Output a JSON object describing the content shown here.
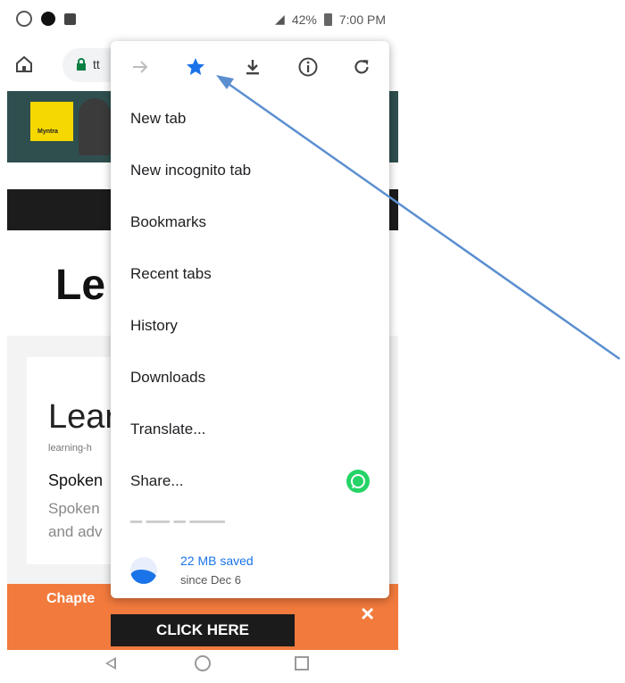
{
  "status_bar": {
    "battery": "42%",
    "time": "7:00 PM"
  },
  "url_bar": {
    "url_fragment": "tt"
  },
  "page": {
    "banner_logo": "Myntra",
    "big_title": "Le",
    "card_title": "Lear",
    "card_subtitle": "learning-h",
    "card_heading": "Spoken",
    "card_desc_line1": "Spoken",
    "card_desc_line2": "and adv",
    "orange_banner_text": "Chapte",
    "close_symbol": "×",
    "click_button": "CLICK HERE"
  },
  "menu": {
    "toolbar_icons": [
      "forward-icon",
      "bookmark-star-icon",
      "download-icon",
      "info-icon",
      "refresh-icon"
    ],
    "items": [
      {
        "label": "New tab"
      },
      {
        "label": "New incognito tab"
      },
      {
        "label": "Bookmarks"
      },
      {
        "label": "Recent tabs"
      },
      {
        "label": "History"
      },
      {
        "label": "Downloads"
      },
      {
        "label": "Translate..."
      },
      {
        "label": "Share..."
      }
    ],
    "data_saved": {
      "amount": "22 MB saved",
      "since": "since Dec 6"
    }
  },
  "colors": {
    "accent_blue": "#1a73e8",
    "annotation_arrow": "#5b8fd0",
    "orange_banner": "#f27a3d",
    "whatsapp_green": "#25d366"
  }
}
